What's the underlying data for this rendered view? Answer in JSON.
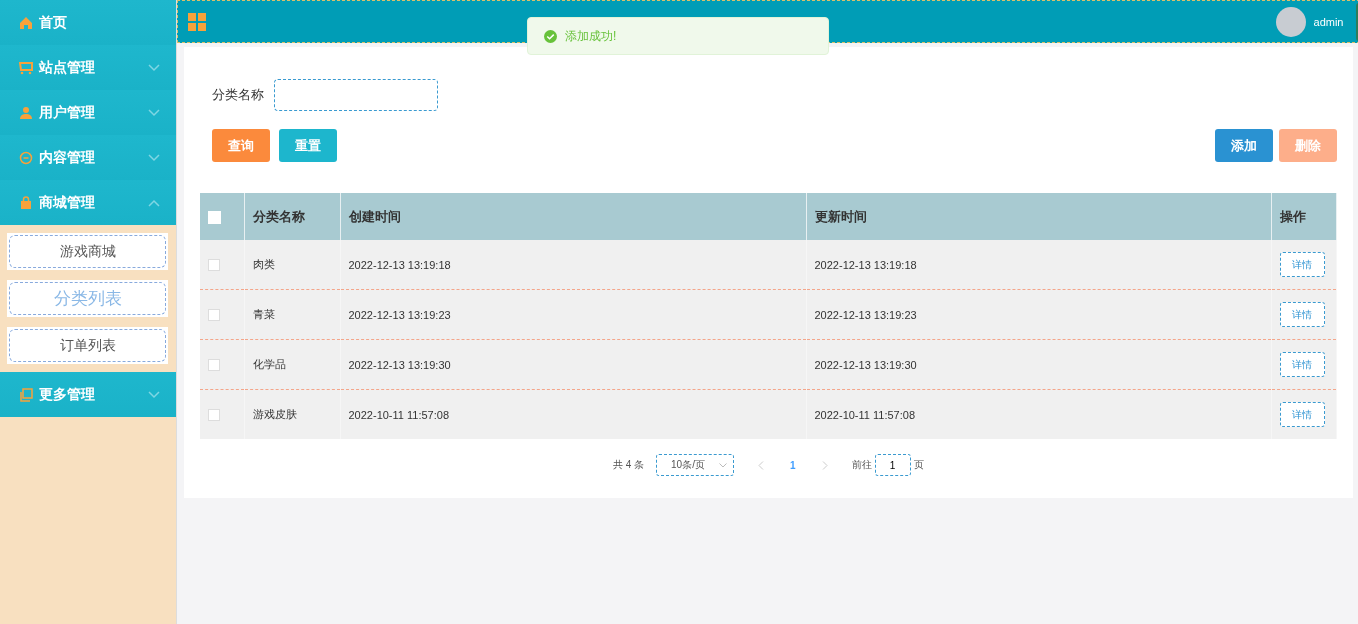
{
  "sidebar": {
    "items": [
      {
        "label": "首页"
      },
      {
        "label": "站点管理",
        "expanded": false
      },
      {
        "label": "用户管理",
        "expanded": false
      },
      {
        "label": "内容管理",
        "expanded": false
      },
      {
        "label": "商城管理",
        "expanded": true,
        "children": [
          {
            "label": "游戏商城",
            "selected": false
          },
          {
            "label": "分类列表",
            "selected": true
          },
          {
            "label": "订单列表",
            "selected": false
          }
        ]
      },
      {
        "label": "更多管理",
        "expanded": false
      }
    ]
  },
  "header": {
    "user": "admin"
  },
  "toast": {
    "message": "添加成功!"
  },
  "search": {
    "label": "分类名称",
    "buttons": [
      {
        "label": "查询",
        "kind": "query"
      },
      {
        "label": "重置",
        "kind": "reset"
      }
    ]
  },
  "actions": [
    {
      "label": "添加",
      "kind": "add",
      "disabled": false
    },
    {
      "label": "删除",
      "kind": "delete",
      "disabled": true
    }
  ],
  "table": {
    "header_checked": false,
    "columns": [
      "分类名称",
      "创建时间",
      "更新时间",
      "操作"
    ],
    "rows": [
      {
        "checked": false,
        "cells": [
          "肉类",
          "2022-12-13 13:19:18",
          "2022-12-13 13:19:18"
        ],
        "action": "详情"
      },
      {
        "checked": false,
        "cells": [
          "青菜",
          "2022-12-13 13:19:23",
          "2022-12-13 13:19:23"
        ],
        "action": "详情"
      },
      {
        "checked": false,
        "cells": [
          "化学品",
          "2022-12-13 13:19:30",
          "2022-12-13 13:19:30"
        ],
        "action": "详情"
      },
      {
        "checked": false,
        "cells": [
          "游戏皮肤",
          "2022-10-11 11:57:08",
          "2022-10-11 11:57:08"
        ],
        "action": "详情"
      }
    ]
  },
  "pagination": {
    "total": "共 4 条",
    "page_size": "10条/页",
    "pages": [
      {
        "label": "1",
        "selected": true
      }
    ],
    "goto_label": "前往",
    "goto_value": "1",
    "goto_suffix": "页"
  }
}
